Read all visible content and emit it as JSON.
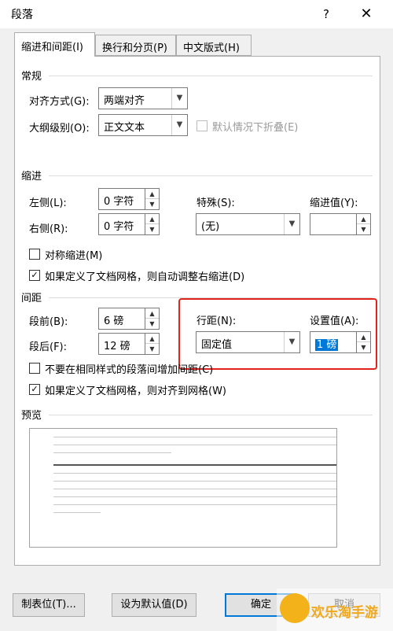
{
  "window": {
    "title": "段落",
    "help": "?",
    "close": "✕"
  },
  "tabs": [
    {
      "label": "缩进和间距(I)",
      "active": true
    },
    {
      "label": "换行和分页(P)",
      "active": false
    },
    {
      "label": "中文版式(H)",
      "active": false
    }
  ],
  "general": {
    "section": "常规",
    "alignment_label": "对齐方式(G):",
    "alignment_value": "两端对齐",
    "outline_label": "大纲级别(O):",
    "outline_value": "正文文本",
    "collapse_label": "默认情况下折叠(E)"
  },
  "indent": {
    "section": "缩进",
    "left_label": "左侧(L):",
    "left_value": "0 字符",
    "right_label": "右侧(R):",
    "right_value": "0 字符",
    "special_label": "特殊(S):",
    "special_value": "(无)",
    "indent_by_label": "缩进值(Y):",
    "indent_by_value": "",
    "mirror_label": "对称缩进(M)",
    "mirror_checked": false,
    "auto_adjust_label": "如果定义了文档网格，则自动调整右缩进(D)",
    "auto_adjust_checked": true
  },
  "spacing": {
    "section": "间距",
    "before_label": "段前(B):",
    "before_value": "6 磅",
    "after_label": "段后(F):",
    "after_value": "12 磅",
    "line_spacing_label": "行距(N):",
    "line_spacing_value": "固定值",
    "at_label": "设置值(A):",
    "at_value": "1 磅",
    "no_space_label": "不要在相同样式的段落间增加间距(C)",
    "no_space_checked": false,
    "snap_grid_label": "如果定义了文档网格，则对齐到网格(W)",
    "snap_grid_checked": true
  },
  "preview": {
    "section": "预览"
  },
  "buttons": {
    "tabs": "制表位(T)...",
    "set_default": "设为默认值(D)",
    "ok": "确定",
    "cancel": "取消"
  },
  "watermark": {
    "text": "欢乐淘手游"
  },
  "icons": {
    "dropdown": "chevron-down-icon",
    "spin_up": "spin-up-icon",
    "spin_down": "spin-down-icon",
    "check": "checkmark-icon"
  },
  "colors": {
    "highlight": "#e0241b",
    "accent": "#0078d7",
    "watermark": "#f0a81c"
  }
}
